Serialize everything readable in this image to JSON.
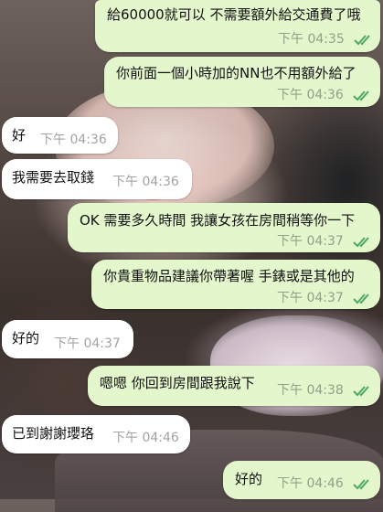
{
  "messages": [
    {
      "text": "給60000就可以 不需要額外給交通費了哦",
      "time": "下午 04:35",
      "direction": "out",
      "status": "read"
    },
    {
      "text": "你前面一個小時加的NN也不用額外給了",
      "time": "下午 04:36",
      "direction": "out",
      "status": "read"
    },
    {
      "text": "好",
      "time": "下午 04:36",
      "direction": "in"
    },
    {
      "text": "我需要去取錢",
      "time": "下午 04:36",
      "direction": "in"
    },
    {
      "text": "OK 需要多久時間 我讓女孩在房間稍等你一下",
      "time": "下午 04:37",
      "direction": "out",
      "status": "read"
    },
    {
      "text": "你貴重物品建議你帶著喔 手錶或是其他的",
      "time": "下午 04:37",
      "direction": "out",
      "status": "read"
    },
    {
      "text": "好的",
      "time": "下午 04:37",
      "direction": "in"
    },
    {
      "text": "嗯嗯 你回到房間跟我說下",
      "time": "下午 04:38",
      "direction": "out",
      "status": "read"
    },
    {
      "text": "已到謝謝瓔珞",
      "time": "下午 04:46",
      "direction": "in"
    },
    {
      "text": "好的",
      "time": "下午 04:46",
      "direction": "out",
      "status": "read"
    }
  ],
  "colors": {
    "outgoing_bubble": "#e4f6cc",
    "incoming_bubble": "#ffffff",
    "read_check": "#4fa86a"
  }
}
